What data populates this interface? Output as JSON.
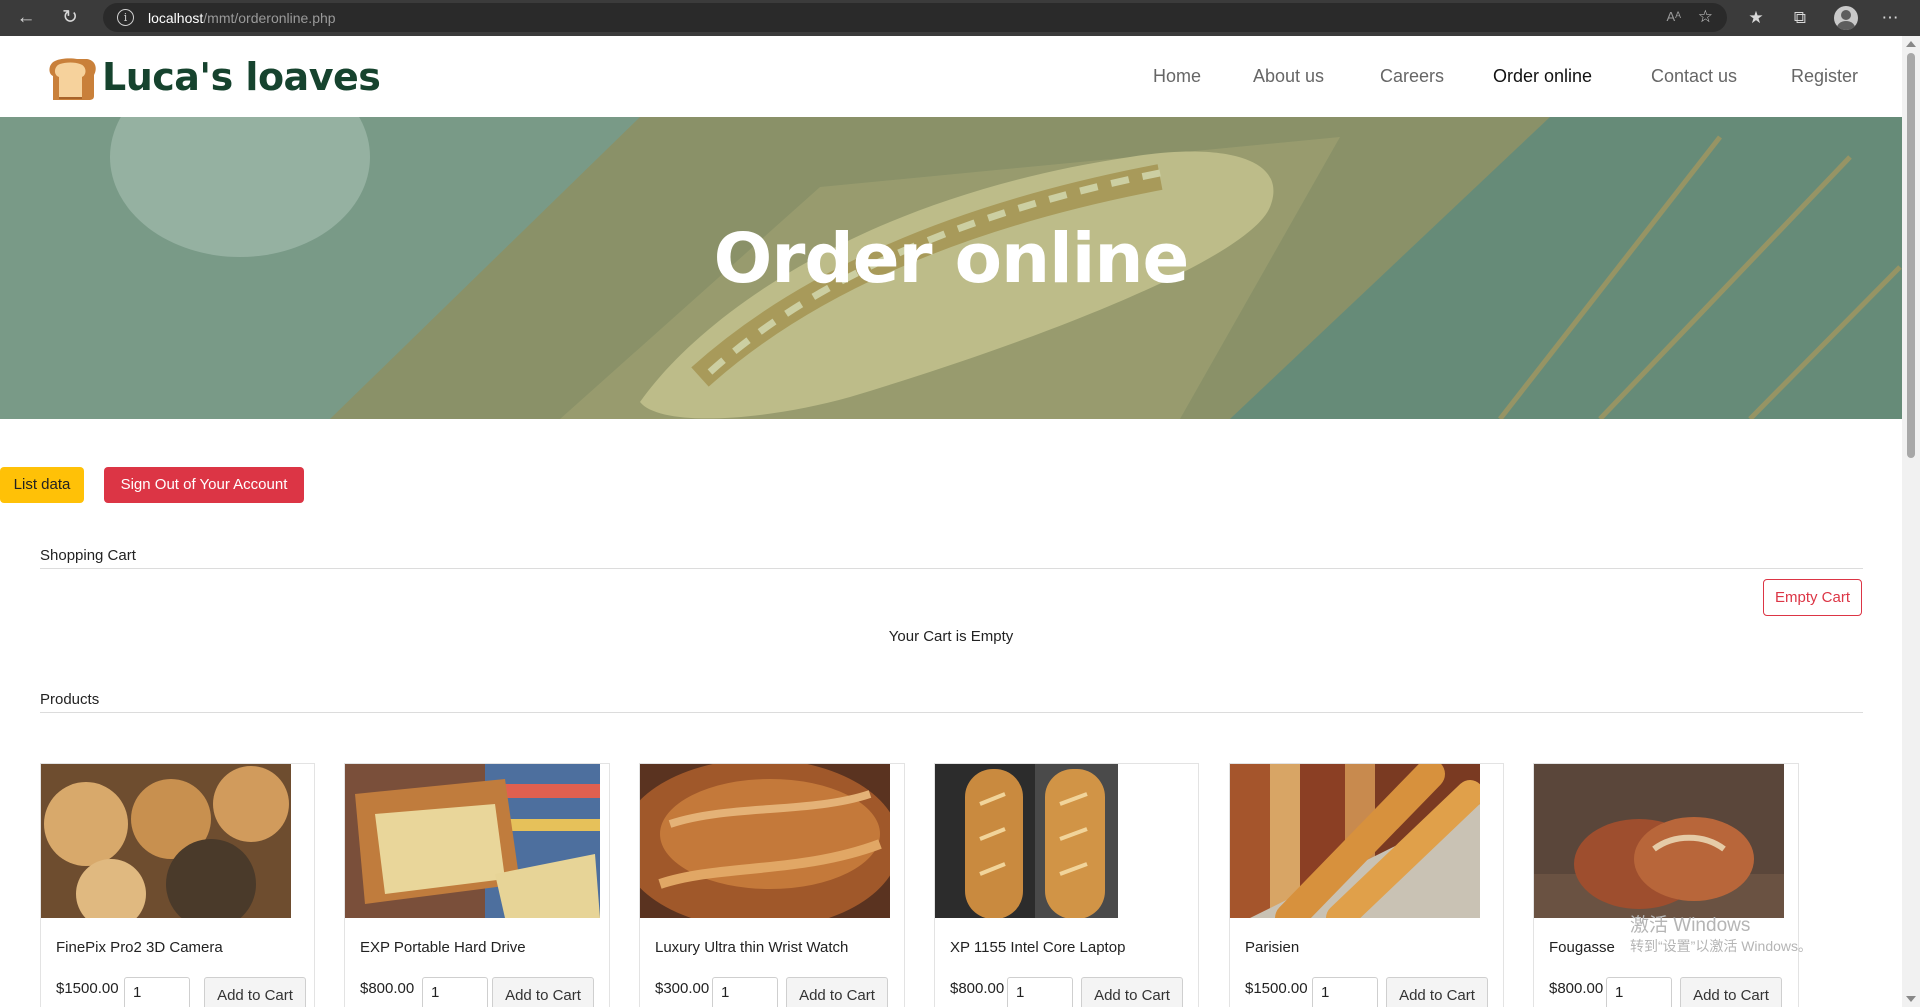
{
  "browser": {
    "url_host": "localhost",
    "url_path": "/mmt/orderonline.php",
    "read_aloud": "Aᴬ"
  },
  "header": {
    "logo_text": "Luca's loaves",
    "nav": [
      "Home",
      "About us",
      "Careers",
      "Order online",
      "Contact us",
      "Register"
    ],
    "active_nav": "Order online"
  },
  "hero": {
    "title": "Order online"
  },
  "actions": {
    "list_data": "List data",
    "sign_out": "Sign Out of Your Account"
  },
  "cart": {
    "heading": "Shopping Cart",
    "empty_button": "Empty Cart",
    "empty_message": "Your Cart is Empty"
  },
  "products": {
    "heading": "Products",
    "add_label": "Add to Cart",
    "items": [
      {
        "name": "FinePix Pro2 3D Camera",
        "price": "$1500.00",
        "qty": "1"
      },
      {
        "name": "EXP Portable Hard Drive",
        "price": "$800.00",
        "qty": "1"
      },
      {
        "name": "Luxury Ultra thin Wrist Watch",
        "price": "$300.00",
        "qty": "1"
      },
      {
        "name": "XP 1155 Intel Core Laptop",
        "price": "$800.00",
        "qty": "1"
      },
      {
        "name": "Parisien",
        "price": "$1500.00",
        "qty": "1"
      },
      {
        "name": "Fougasse",
        "price": "$800.00",
        "qty": "1"
      }
    ]
  },
  "watermark": {
    "line1": "激活 Windows",
    "line2": "转到“设置”以激活 Windows。"
  },
  "colors": {
    "brand_green": "#16432e",
    "warning": "#ffc107",
    "danger": "#dc3545",
    "hero_overlay": "#7c9c8a"
  }
}
